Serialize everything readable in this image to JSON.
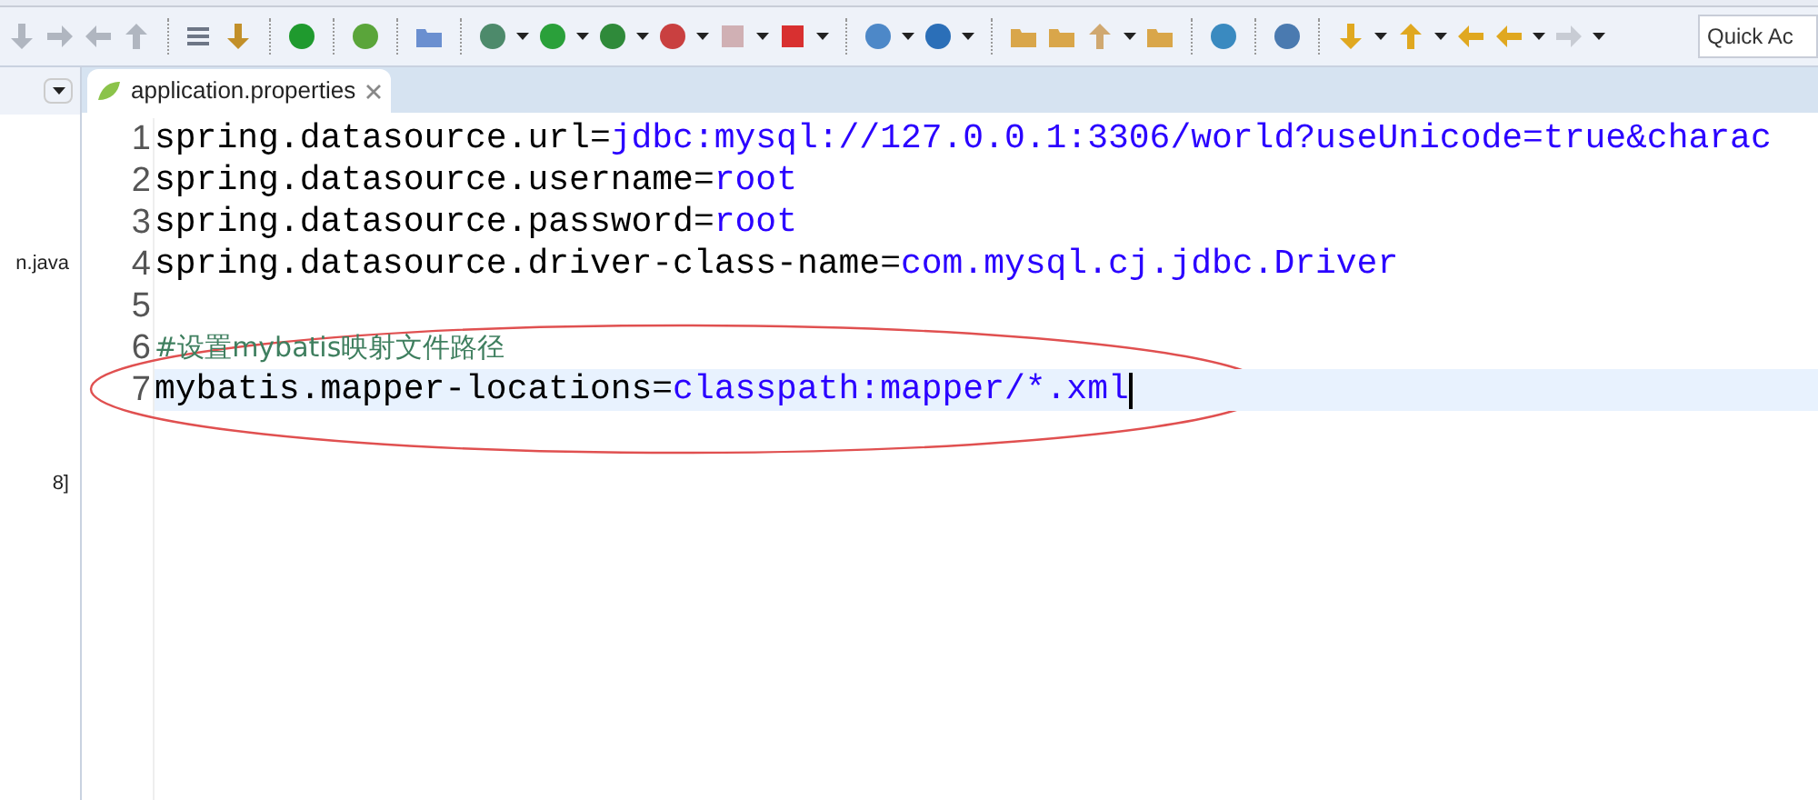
{
  "toolbar": {
    "quick_access": {
      "placeholder": "Quick Ac"
    }
  },
  "left_panel": {
    "items": [
      "n.java",
      "8]"
    ]
  },
  "editor": {
    "tab": {
      "label": "application.properties",
      "selected": true
    },
    "lines": [
      {
        "number": "1",
        "current": false,
        "parts": [
          {
            "kind": "key",
            "text": "spring.datasource.url="
          },
          {
            "kind": "value",
            "text": "jdbc:mysql://127.0.0.1:3306/world?useUnicode=true&charac"
          }
        ]
      },
      {
        "number": "2",
        "current": false,
        "parts": [
          {
            "kind": "key",
            "text": "spring.datasource.username="
          },
          {
            "kind": "value",
            "text": "root"
          }
        ]
      },
      {
        "number": "3",
        "current": false,
        "parts": [
          {
            "kind": "key",
            "text": "spring.datasource.password="
          },
          {
            "kind": "value",
            "text": "root"
          }
        ]
      },
      {
        "number": "4",
        "current": false,
        "parts": [
          {
            "kind": "key",
            "text": "spring.datasource.driver-class-name="
          },
          {
            "kind": "value",
            "text": "com.mysql.cj.jdbc.Driver"
          }
        ]
      },
      {
        "number": "5",
        "current": false
      },
      {
        "number": "6",
        "current": false,
        "parts": [
          {
            "kind": "comment",
            "text": "#设置mybatis映射文件路径"
          }
        ]
      },
      {
        "number": "7",
        "current": true,
        "parts": [
          {
            "kind": "key",
            "text": "mybatis.mapper-locations="
          },
          {
            "kind": "value",
            "text": "classpath:mapper/*.xml"
          }
        ]
      }
    ]
  }
}
